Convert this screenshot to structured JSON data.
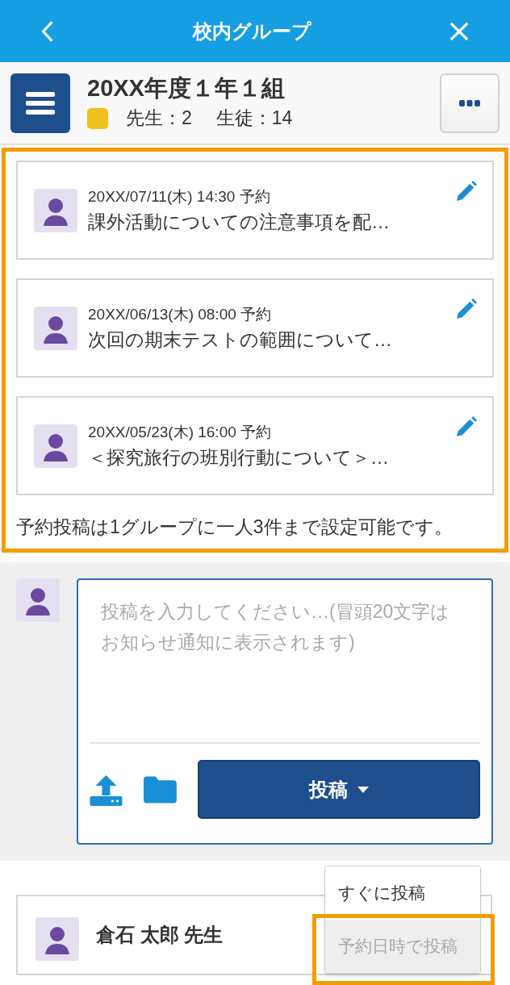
{
  "header": {
    "title": "校内グループ"
  },
  "group": {
    "name": "20XX年度１年１組",
    "color": "#efc11f",
    "teachers": "先生：2",
    "students": "生徒：14"
  },
  "scheduled_posts": [
    {
      "time": "20XX/07/11(木) 14:30 予約",
      "text": "課外活動についての注意事項を配…"
    },
    {
      "time": "20XX/06/13(木) 08:00 予約",
      "text": "次回の期末テストの範囲について…"
    },
    {
      "time": "20XX/05/23(木) 16:00 予約",
      "text": "＜探究旅行の班別行動について＞…"
    }
  ],
  "note": "予約投稿は1グループに一人3件まで設定可能です。",
  "composer": {
    "placeholder": "投稿を入力してください…(冒頭20文字はお知らせ通知に表示されます)",
    "post_button": "投稿"
  },
  "post_menu": [
    {
      "label": "すぐに投稿",
      "disabled": false
    },
    {
      "label": "予約日時で投稿",
      "disabled": true
    }
  ],
  "feed": [
    {
      "author": "倉石 太郎 先生"
    }
  ]
}
